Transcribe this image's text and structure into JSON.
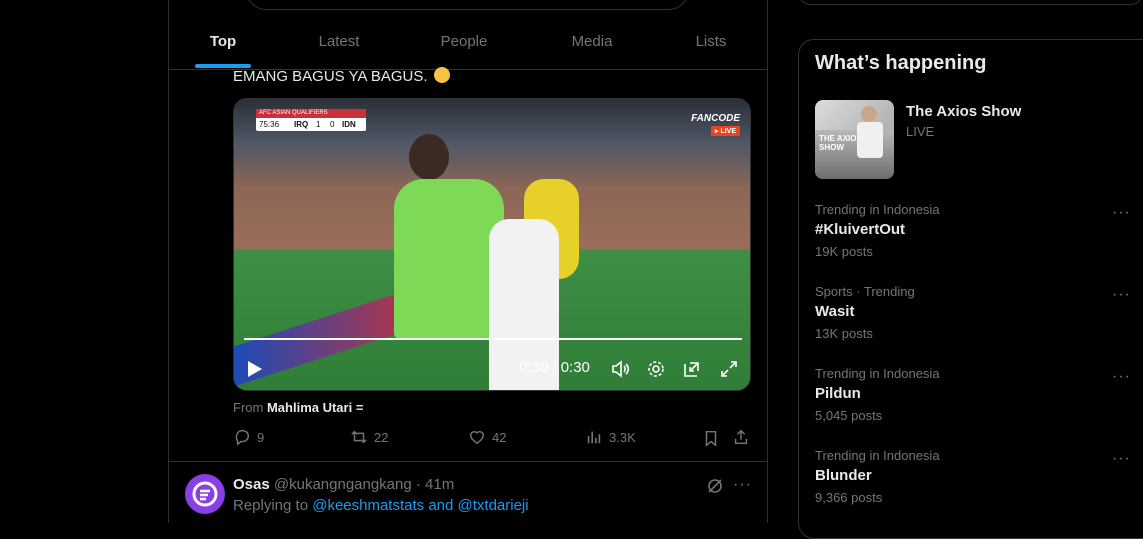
{
  "tabs": [
    "Top",
    "Latest",
    "People",
    "Media",
    "Lists"
  ],
  "tweet": {
    "text": "EMANG BAGUS YA BAGUS.",
    "video": {
      "scorebug_header": "AFC ASIAN QUALIFIERS",
      "clock": "75:36",
      "team_home": "IRQ",
      "score_home": "1",
      "score_away": "0",
      "team_away": "IDN",
      "broadcaster": "FANCODE",
      "broadcaster_live": "LIVE",
      "time_label": "0:30 / 0:30",
      "progress_fraction": 1.0
    },
    "from_prefix": "From",
    "from_user": "Mahlima Utari =",
    "actions": {
      "replies": "9",
      "reposts": "22",
      "likes": "42",
      "views": "3.3K"
    }
  },
  "reply": {
    "name": "Osas",
    "handle_time": "@kukangngangkang · 41m",
    "replying_prefix": "Replying to",
    "replying_to": "@keeshmatstats and @txtdarieji",
    "more": "···"
  },
  "sidebar": {
    "title": "What’s happening",
    "featured": {
      "title": "The Axios Show",
      "status": "LIVE",
      "thumb_text": "THE AXIOS SHOW"
    },
    "trends": [
      {
        "meta": "Trending in Indonesia",
        "name": "#KluivertOut",
        "count": "19K posts"
      },
      {
        "meta": "Sports · Trending",
        "name": "Wasit",
        "count": "13K posts"
      },
      {
        "meta": "Trending in Indonesia",
        "name": "Pildun",
        "count": "5,045 posts"
      },
      {
        "meta": "Trending in Indonesia",
        "name": "Blunder",
        "count": "9,366 posts"
      }
    ],
    "more": "···"
  },
  "colors": {
    "accent": "#1d9bf0",
    "background": "#000000",
    "border": "#2f3336",
    "muted_text": "#71767b",
    "text": "#e7e9ea"
  }
}
